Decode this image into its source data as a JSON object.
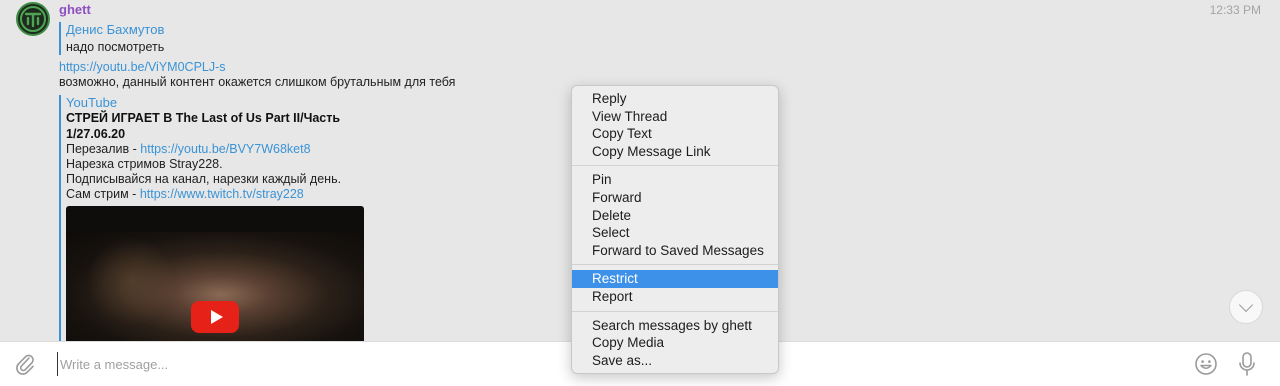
{
  "message": {
    "sender": "ghett",
    "time": "12:33 PM",
    "reply": {
      "author": "Денис Бахмутов",
      "text": "надо посмотреть"
    },
    "link": "https://youtu.be/ViYM0CPLJ-s",
    "text": "возможно, данный контент окажется слишком брутальным для тебя",
    "preview": {
      "site": "YouTube",
      "title": "СТРЕЙ ИГРАЕТ В The Last of Us Part II/Часть 1/27.06.20",
      "line1_label": "Перезалив - ",
      "line1_link": "https://youtu.be/BVY7W68ket8",
      "line2": "Нарезка стримов Stray228.",
      "line3": "Подписывайся на канал, нарезки каждый день.",
      "line4_label": "Сам стрим - ",
      "line4_link": "https://www.twitch.tv/stray228"
    }
  },
  "context_menu": {
    "group1": [
      "Reply",
      "View Thread",
      "Copy Text",
      "Copy Message Link"
    ],
    "group2": [
      "Pin",
      "Forward",
      "Delete",
      "Select",
      "Forward to Saved Messages"
    ],
    "group3": [
      "Restrict",
      "Report"
    ],
    "group4": [
      "Search messages by ghett",
      "Copy Media",
      "Save as..."
    ],
    "highlighted": "Restrict"
  },
  "composer": {
    "placeholder": "Write a message..."
  },
  "icons": {
    "avatar": "channel-logo",
    "attach": "paperclip-icon",
    "emoji": "emoji-icon",
    "mic": "microphone-icon",
    "scroll": "chevron-down-icon",
    "play": "play-icon"
  },
  "colors": {
    "accent": "#3a93d6",
    "sender": "#8e4fc2",
    "highlight": "#3e91e8",
    "play_button": "#e62117"
  }
}
